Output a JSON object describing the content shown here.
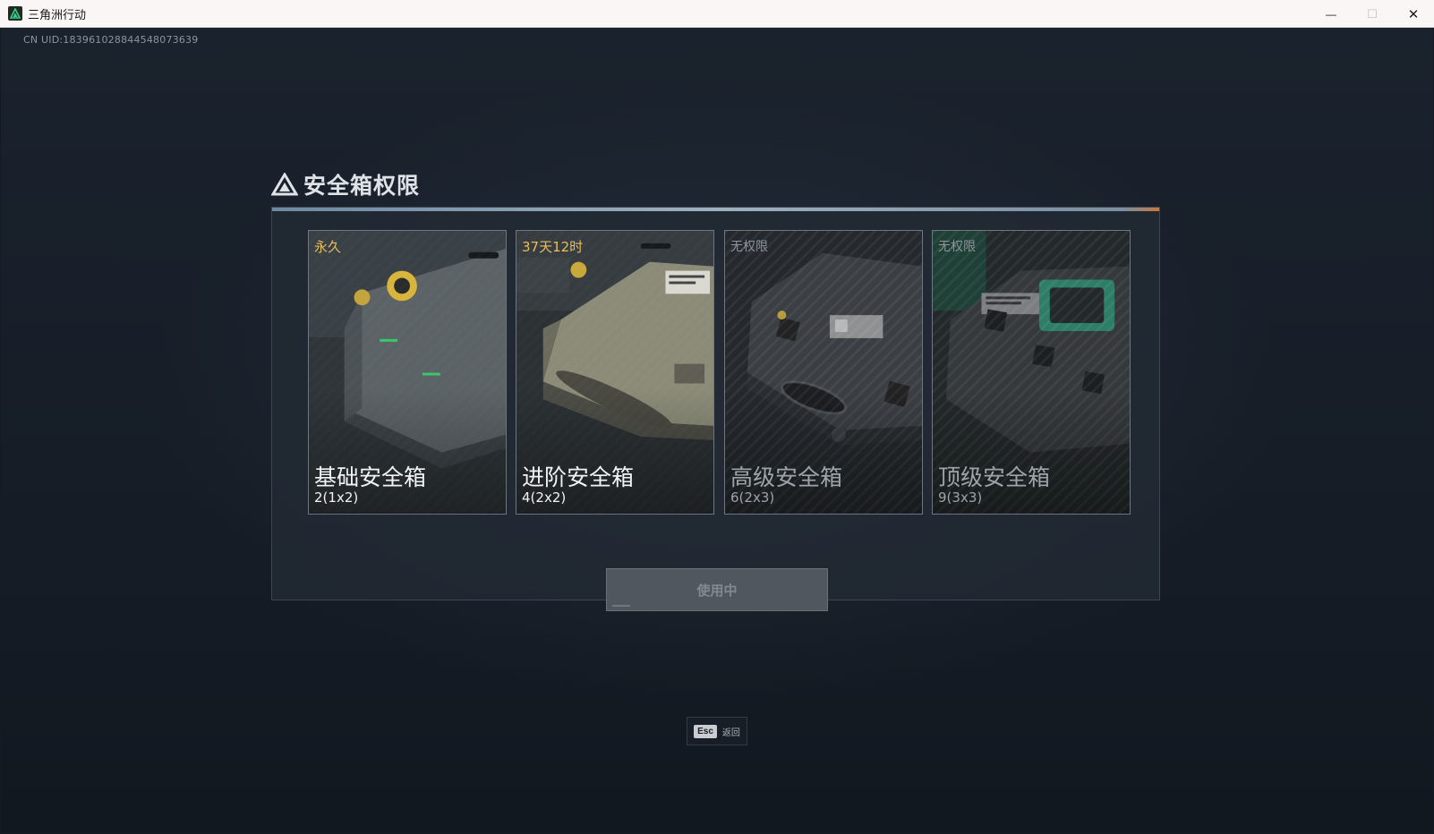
{
  "window": {
    "title": "三角洲行动",
    "controls": {
      "minimize": "—",
      "maximize": "☐",
      "close": "✕"
    }
  },
  "uid_text": "CN UID:183961028844548073639",
  "panel": {
    "title": "安全箱权限"
  },
  "cards": [
    {
      "status": "永久",
      "name": "基础安全箱",
      "capacity": "2(1x2)",
      "state": "active"
    },
    {
      "status": "37天12时",
      "name": "进阶安全箱",
      "capacity": "4(2x2)",
      "state": "active"
    },
    {
      "status": "无权限",
      "name": "高级安全箱",
      "capacity": "6(2x3)",
      "state": "locked"
    },
    {
      "status": "无权限",
      "name": "顶级安全箱",
      "capacity": "9(3x3)",
      "state": "locked"
    }
  ],
  "action_button": {
    "label": "使用中"
  },
  "esc_hint": {
    "key": "Esc",
    "label": "返回"
  },
  "colors": {
    "accent_gold": "#e8bf5a",
    "panel_bg": "#222a34",
    "teal_accent": "#2a7a62"
  }
}
